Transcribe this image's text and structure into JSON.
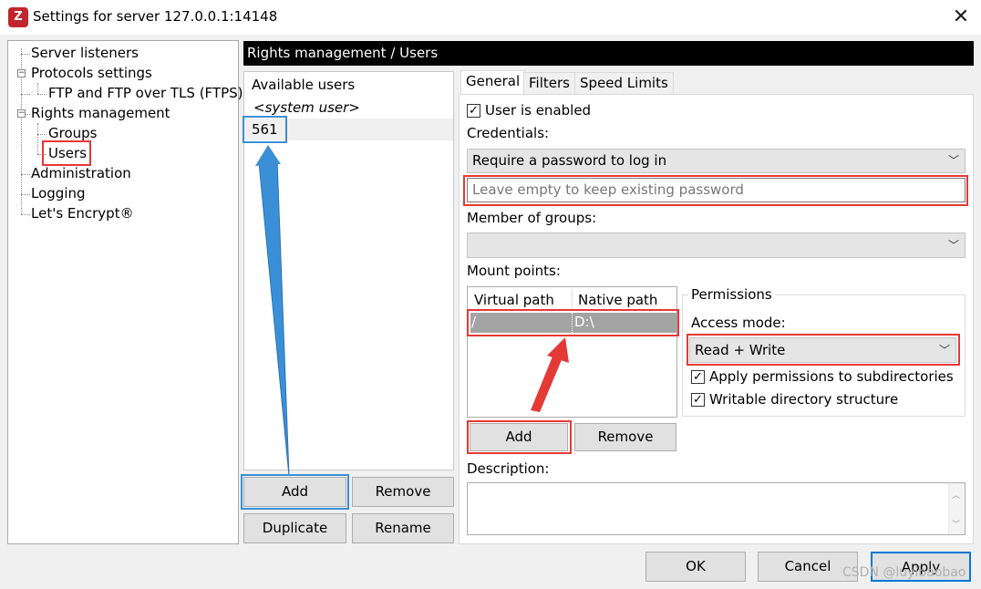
{
  "window": {
    "title": "Settings for server 127.0.0.1:14148",
    "icon_name": "filezilla-icon",
    "close_glyph": "✕"
  },
  "tree": {
    "items": [
      {
        "label": "Server listeners"
      },
      {
        "label": "Protocols settings"
      },
      {
        "label": "FTP and FTP over TLS (FTPS)"
      },
      {
        "label": "Rights management"
      },
      {
        "label": "Groups"
      },
      {
        "label": "Users"
      },
      {
        "label": "Administration"
      },
      {
        "label": "Logging"
      },
      {
        "label": "Let's Encrypt®"
      }
    ],
    "selected": "Users"
  },
  "header": {
    "title": "Rights management / Users"
  },
  "users": {
    "heading": "Available users",
    "system_user": "<system user>",
    "items": [
      "561"
    ],
    "add_label": "Add",
    "remove_label": "Remove",
    "duplicate_label": "Duplicate",
    "rename_label": "Rename"
  },
  "tabs": [
    {
      "label": "General"
    },
    {
      "label": "Filters"
    },
    {
      "label": "Speed Limits"
    }
  ],
  "general": {
    "user_enabled_label": "User is enabled",
    "user_enabled_checked": true,
    "credentials_label": "Credentials:",
    "credentials_value": "Require a password to log in",
    "password_placeholder": "Leave empty to keep existing password",
    "member_label": "Member of groups:",
    "member_value": "",
    "mount_label": "Mount points:",
    "mount_columns": [
      "Virtual path",
      "Native path"
    ],
    "mount_rows": [
      {
        "virtual": "/",
        "native": "D:\\"
      }
    ],
    "mount_add": "Add",
    "mount_remove": "Remove",
    "permissions_title": "Permissions",
    "access_mode_label": "Access mode:",
    "access_mode_value": "Read + Write",
    "apply_subdirs_label": "Apply permissions to subdirectories",
    "apply_subdirs_checked": true,
    "writable_dirs_label": "Writable directory structure",
    "writable_dirs_checked": true,
    "description_label": "Description:",
    "description_value": ""
  },
  "footer": {
    "ok": "OK",
    "cancel": "Cancel",
    "apply": "Apply"
  },
  "watermark": "CSDN @luyibaobao",
  "colors": {
    "annotation_red": "#e53935",
    "annotation_blue": "#3b8fd6",
    "header_bg": "#000000"
  }
}
